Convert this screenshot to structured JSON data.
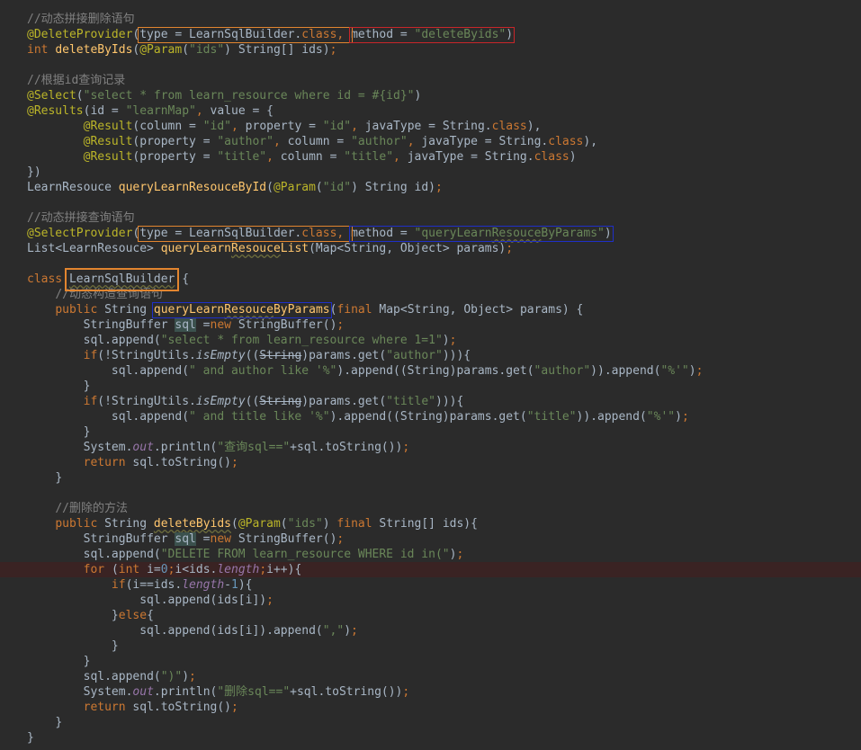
{
  "editor": {
    "highlighted_line": 36,
    "lines": [
      [
        {
          "t": "//动态拼接删除语句",
          "s": "com"
        }
      ],
      [
        {
          "t": "@DeleteProvider",
          "s": "ann"
        },
        {
          "t": "(",
          "s": "plain"
        },
        {
          "t": "type",
          "s": "plain"
        },
        {
          "t": " = LearnSqlBuilder.",
          "s": "plain"
        },
        {
          "t": "class",
          "s": "kw"
        },
        {
          "t": ", ",
          "s": "kw"
        },
        {
          "t": "method",
          "s": "plain"
        },
        {
          "t": " = ",
          "s": "plain"
        },
        {
          "t": "\"deleteByids\"",
          "s": "str"
        },
        {
          "t": ")",
          "s": "plain"
        }
      ],
      [
        {
          "t": "int ",
          "s": "kw"
        },
        {
          "t": "deleteByIds",
          "s": "fn"
        },
        {
          "t": "(",
          "s": "plain"
        },
        {
          "t": "@Param",
          "s": "ann"
        },
        {
          "t": "(",
          "s": "plain"
        },
        {
          "t": "\"ids\"",
          "s": "str"
        },
        {
          "t": ") String[] ids)",
          "s": "plain"
        },
        {
          "t": ";",
          "s": "kw"
        }
      ],
      [],
      [
        {
          "t": "//根据id查询记录",
          "s": "com"
        }
      ],
      [
        {
          "t": "@Select",
          "s": "ann"
        },
        {
          "t": "(",
          "s": "plain"
        },
        {
          "t": "\"select * from learn_resource where id = #{id}\"",
          "s": "str"
        },
        {
          "t": ")",
          "s": "plain"
        }
      ],
      [
        {
          "t": "@Results",
          "s": "ann"
        },
        {
          "t": "(id = ",
          "s": "plain"
        },
        {
          "t": "\"learnMap\"",
          "s": "str"
        },
        {
          "t": ", ",
          "s": "kw"
        },
        {
          "t": "value = {",
          "s": "plain"
        }
      ],
      [
        {
          "t": "        "
        },
        {
          "t": "@Result",
          "s": "ann"
        },
        {
          "t": "(column = ",
          "s": "plain"
        },
        {
          "t": "\"id\"",
          "s": "str"
        },
        {
          "t": ", ",
          "s": "kw"
        },
        {
          "t": "property = ",
          "s": "plain"
        },
        {
          "t": "\"id\"",
          "s": "str"
        },
        {
          "t": ", ",
          "s": "kw"
        },
        {
          "t": "javaType = String.",
          "s": "plain"
        },
        {
          "t": "class",
          "s": "kw"
        },
        {
          "t": "),",
          "s": "plain"
        }
      ],
      [
        {
          "t": "        "
        },
        {
          "t": "@Result",
          "s": "ann"
        },
        {
          "t": "(property = ",
          "s": "plain"
        },
        {
          "t": "\"author\"",
          "s": "str"
        },
        {
          "t": ", ",
          "s": "kw"
        },
        {
          "t": "column = ",
          "s": "plain"
        },
        {
          "t": "\"author\"",
          "s": "str"
        },
        {
          "t": ", ",
          "s": "kw"
        },
        {
          "t": "javaType = String.",
          "s": "plain"
        },
        {
          "t": "class",
          "s": "kw"
        },
        {
          "t": "),",
          "s": "plain"
        }
      ],
      [
        {
          "t": "        "
        },
        {
          "t": "@Result",
          "s": "ann"
        },
        {
          "t": "(property = ",
          "s": "plain"
        },
        {
          "t": "\"title\"",
          "s": "str"
        },
        {
          "t": ", ",
          "s": "kw"
        },
        {
          "t": "column = ",
          "s": "plain"
        },
        {
          "t": "\"title\"",
          "s": "str"
        },
        {
          "t": ", ",
          "s": "kw"
        },
        {
          "t": "javaType = String.",
          "s": "plain"
        },
        {
          "t": "class",
          "s": "kw"
        },
        {
          "t": ")",
          "s": "plain"
        }
      ],
      [
        {
          "t": "})",
          "s": "plain"
        }
      ],
      [
        {
          "t": "LearnResouce ",
          "s": "plain"
        },
        {
          "t": "queryLearnResouceById",
          "s": "fn"
        },
        {
          "t": "(",
          "s": "plain"
        },
        {
          "t": "@Param",
          "s": "ann"
        },
        {
          "t": "(",
          "s": "plain"
        },
        {
          "t": "\"id\"",
          "s": "str"
        },
        {
          "t": ") String id)",
          "s": "plain"
        },
        {
          "t": ";",
          "s": "kw"
        }
      ],
      [],
      [
        {
          "t": "//动态拼接查询语句",
          "s": "com"
        }
      ],
      [
        {
          "t": "@SelectProvider",
          "s": "ann"
        },
        {
          "t": "(",
          "s": "plain"
        },
        {
          "t": "type",
          "s": "plain"
        },
        {
          "t": " = LearnSqlBuilder.",
          "s": "plain"
        },
        {
          "t": "class",
          "s": "kw"
        },
        {
          "t": ", ",
          "s": "kw"
        },
        {
          "t": "method",
          "s": "plain"
        },
        {
          "t": " = ",
          "s": "plain"
        },
        {
          "t": "\"queryLearn",
          "s": "str"
        },
        {
          "t": "Resouce",
          "s": "str",
          "w": 1
        },
        {
          "t": "ByParams\"",
          "s": "str"
        },
        {
          "t": ")",
          "s": "plain"
        }
      ],
      [
        {
          "t": "List<LearnResouce> ",
          "s": "plain"
        },
        {
          "t": "queryLearn",
          "s": "fn"
        },
        {
          "t": "Resouce",
          "s": "fn",
          "w": 1
        },
        {
          "t": "List",
          "s": "fn"
        },
        {
          "t": "(Map<String, Object> params)",
          "s": "plain"
        },
        {
          "t": ";",
          "s": "kw"
        }
      ],
      [],
      [
        {
          "t": "class ",
          "s": "kw"
        },
        {
          "t": "LearnSqlBuilder",
          "s": "plain",
          "w": 1
        },
        {
          "t": " {",
          "s": "plain"
        }
      ],
      [
        {
          "t": "    "
        },
        {
          "t": "//动态构造查询语句",
          "s": "com"
        }
      ],
      [
        {
          "t": "    "
        },
        {
          "t": "public ",
          "s": "kw"
        },
        {
          "t": "String ",
          "s": "plain"
        },
        {
          "t": "queryLearn",
          "s": "fn"
        },
        {
          "t": "Resouce",
          "s": "fn",
          "w": 1
        },
        {
          "t": "ByParams",
          "s": "fn"
        },
        {
          "t": "(",
          "s": "plain"
        },
        {
          "t": "final ",
          "s": "kw"
        },
        {
          "t": "Map<String, Object> params) {",
          "s": "plain"
        }
      ],
      [
        {
          "t": "        "
        },
        {
          "t": "StringBuffer ",
          "s": "plain"
        },
        {
          "t": "sql",
          "s": "plain",
          "q": 1
        },
        {
          "t": " =",
          "s": "plain"
        },
        {
          "t": "new ",
          "s": "kw"
        },
        {
          "t": "StringBuffer()",
          "s": "plain"
        },
        {
          "t": ";",
          "s": "kw"
        }
      ],
      [
        {
          "t": "        "
        },
        {
          "t": "sql.append(",
          "s": "plain"
        },
        {
          "t": "\"select * from learn_resource where 1=1\"",
          "s": "str"
        },
        {
          "t": ")",
          "s": "plain"
        },
        {
          "t": ";",
          "s": "kw"
        }
      ],
      [
        {
          "t": "        "
        },
        {
          "t": "if",
          "s": "kw"
        },
        {
          "t": "(!StringUtils.",
          "s": "plain"
        },
        {
          "t": "isEmpty",
          "s": "plain",
          "i": 1
        },
        {
          "t": "((",
          "s": "plain"
        },
        {
          "t": "String",
          "s": "plain",
          "x": 1
        },
        {
          "t": ")params.get(",
          "s": "plain"
        },
        {
          "t": "\"author\"",
          "s": "str"
        },
        {
          "t": "))){",
          "s": "plain"
        }
      ],
      [
        {
          "t": "            "
        },
        {
          "t": "sql.append(",
          "s": "plain"
        },
        {
          "t": "\" and author like '%\"",
          "s": "str"
        },
        {
          "t": ").append((String)params.get(",
          "s": "plain"
        },
        {
          "t": "\"author\"",
          "s": "str"
        },
        {
          "t": ")).append(",
          "s": "plain"
        },
        {
          "t": "\"%'\"",
          "s": "str"
        },
        {
          "t": ")",
          "s": "plain"
        },
        {
          "t": ";",
          "s": "kw"
        }
      ],
      [
        {
          "t": "        "
        },
        {
          "t": "}",
          "s": "plain"
        }
      ],
      [
        {
          "t": "        "
        },
        {
          "t": "if",
          "s": "kw"
        },
        {
          "t": "(!StringUtils.",
          "s": "plain"
        },
        {
          "t": "isEmpty",
          "s": "plain",
          "i": 1
        },
        {
          "t": "((",
          "s": "plain"
        },
        {
          "t": "String",
          "s": "plain",
          "x": 1
        },
        {
          "t": ")params.get(",
          "s": "plain"
        },
        {
          "t": "\"title\"",
          "s": "str"
        },
        {
          "t": "))){",
          "s": "plain"
        }
      ],
      [
        {
          "t": "            "
        },
        {
          "t": "sql.append(",
          "s": "plain"
        },
        {
          "t": "\" and title like '%\"",
          "s": "str"
        },
        {
          "t": ").append((String)params.get(",
          "s": "plain"
        },
        {
          "t": "\"title\"",
          "s": "str"
        },
        {
          "t": ")).append(",
          "s": "plain"
        },
        {
          "t": "\"%'\"",
          "s": "str"
        },
        {
          "t": ")",
          "s": "plain"
        },
        {
          "t": ";",
          "s": "kw"
        }
      ],
      [
        {
          "t": "        "
        },
        {
          "t": "}",
          "s": "plain"
        }
      ],
      [
        {
          "t": "        "
        },
        {
          "t": "System.",
          "s": "plain"
        },
        {
          "t": "out",
          "s": "field"
        },
        {
          "t": ".println(",
          "s": "plain"
        },
        {
          "t": "\"查询sql==\"",
          "s": "str"
        },
        {
          "t": "+sql.toString())",
          "s": "plain"
        },
        {
          "t": ";",
          "s": "kw"
        }
      ],
      [
        {
          "t": "        "
        },
        {
          "t": "return ",
          "s": "kw"
        },
        {
          "t": "sql.toString()",
          "s": "plain"
        },
        {
          "t": ";",
          "s": "kw"
        }
      ],
      [
        {
          "t": "    "
        },
        {
          "t": "}",
          "s": "plain"
        }
      ],
      [],
      [
        {
          "t": "    "
        },
        {
          "t": "//删除的方法",
          "s": "com"
        }
      ],
      [
        {
          "t": "    "
        },
        {
          "t": "public ",
          "s": "kw"
        },
        {
          "t": "String ",
          "s": "plain"
        },
        {
          "t": "deleteByids",
          "s": "fn",
          "w": 1
        },
        {
          "t": "(",
          "s": "plain"
        },
        {
          "t": "@Param",
          "s": "ann"
        },
        {
          "t": "(",
          "s": "plain"
        },
        {
          "t": "\"ids\"",
          "s": "str"
        },
        {
          "t": ") ",
          "s": "plain"
        },
        {
          "t": "final ",
          "s": "kw"
        },
        {
          "t": "String[] ids){",
          "s": "plain"
        }
      ],
      [
        {
          "t": "        "
        },
        {
          "t": "StringBuffer ",
          "s": "plain"
        },
        {
          "t": "sql",
          "s": "plain",
          "q": 1
        },
        {
          "t": " =",
          "s": "plain"
        },
        {
          "t": "new ",
          "s": "kw"
        },
        {
          "t": "StringBuffer()",
          "s": "plain"
        },
        {
          "t": ";",
          "s": "kw"
        }
      ],
      [
        {
          "t": "        "
        },
        {
          "t": "sql.append(",
          "s": "plain"
        },
        {
          "t": "\"DELETE FROM learn_resource WHERE id in(\"",
          "s": "str"
        },
        {
          "t": ")",
          "s": "plain"
        },
        {
          "t": ";",
          "s": "kw"
        }
      ],
      [
        {
          "t": "        "
        },
        {
          "t": "for ",
          "s": "kw"
        },
        {
          "t": "(",
          "s": "plain"
        },
        {
          "t": "int ",
          "s": "kw"
        },
        {
          "t": "i=",
          "s": "plain"
        },
        {
          "t": "0",
          "s": "num"
        },
        {
          "t": ";",
          "s": "kw"
        },
        {
          "t": "i<ids.",
          "s": "plain"
        },
        {
          "t": "length",
          "s": "field"
        },
        {
          "t": ";",
          "s": "kw"
        },
        {
          "t": "i++){",
          "s": "plain"
        }
      ],
      [
        {
          "t": "            "
        },
        {
          "t": "if",
          "s": "kw"
        },
        {
          "t": "(i==ids.",
          "s": "plain"
        },
        {
          "t": "length",
          "s": "field"
        },
        {
          "t": "-",
          "s": "plain"
        },
        {
          "t": "1",
          "s": "num"
        },
        {
          "t": "){",
          "s": "plain"
        }
      ],
      [
        {
          "t": "                "
        },
        {
          "t": "sql.append(ids[i])",
          "s": "plain"
        },
        {
          "t": ";",
          "s": "kw"
        }
      ],
      [
        {
          "t": "            "
        },
        {
          "t": "}",
          "s": "plain"
        },
        {
          "t": "else",
          "s": "kw"
        },
        {
          "t": "{",
          "s": "plain"
        }
      ],
      [
        {
          "t": "                "
        },
        {
          "t": "sql.append(ids[i]).append(",
          "s": "plain"
        },
        {
          "t": "\",\"",
          "s": "str"
        },
        {
          "t": ")",
          "s": "plain"
        },
        {
          "t": ";",
          "s": "kw"
        }
      ],
      [
        {
          "t": "            "
        },
        {
          "t": "}",
          "s": "plain"
        }
      ],
      [
        {
          "t": "        "
        },
        {
          "t": "}",
          "s": "plain"
        }
      ],
      [
        {
          "t": "        "
        },
        {
          "t": "sql.append(",
          "s": "plain"
        },
        {
          "t": "\")\"",
          "s": "str"
        },
        {
          "t": ")",
          "s": "plain"
        },
        {
          "t": ";",
          "s": "kw"
        }
      ],
      [
        {
          "t": "        "
        },
        {
          "t": "System.",
          "s": "plain"
        },
        {
          "t": "out",
          "s": "field"
        },
        {
          "t": ".println(",
          "s": "plain"
        },
        {
          "t": "\"删除sql==\"",
          "s": "str"
        },
        {
          "t": "+sql.toString())",
          "s": "plain"
        },
        {
          "t": ";",
          "s": "kw"
        }
      ],
      [
        {
          "t": "        "
        },
        {
          "t": "return ",
          "s": "kw"
        },
        {
          "t": "sql.toString()",
          "s": "plain"
        },
        {
          "t": ";",
          "s": "kw"
        }
      ],
      [
        {
          "t": "    "
        },
        {
          "t": "}",
          "s": "plain"
        }
      ],
      [
        {
          "t": "}",
          "s": "plain"
        }
      ]
    ]
  },
  "colors": {
    "background": "#2b2b2b",
    "annotation_orange": "#e2852f",
    "annotation_red": "#c8262a",
    "annotation_blue": "#1f2fc8"
  }
}
